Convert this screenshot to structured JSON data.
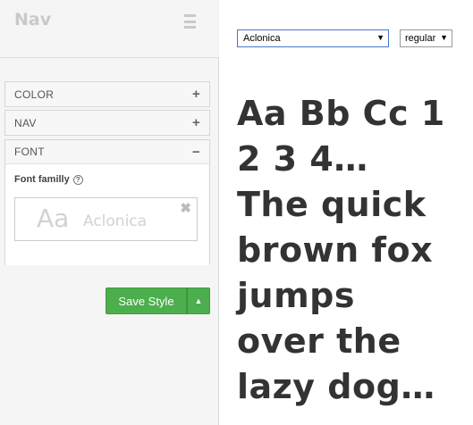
{
  "panel": {
    "title": "Nav",
    "sections": [
      {
        "label": "COLOR",
        "sign": "+"
      },
      {
        "label": "NAV",
        "sign": "+"
      },
      {
        "label": "FONT",
        "sign": "−"
      }
    ],
    "font_field_label": "Font familly",
    "preview": {
      "aa": "Aa",
      "name": "Aclonica",
      "close": "✖"
    }
  },
  "actions": {
    "save_label": "Save Style",
    "caret": "▲"
  },
  "toolbar": {
    "font_value": "Aclonica",
    "weight_value": "regular"
  },
  "sample_lines": [
    "Aa Bb Cc 1",
    "2 3 4…",
    "The quick",
    "brown fox",
    "jumps",
    "over the",
    "lazy dog…"
  ]
}
